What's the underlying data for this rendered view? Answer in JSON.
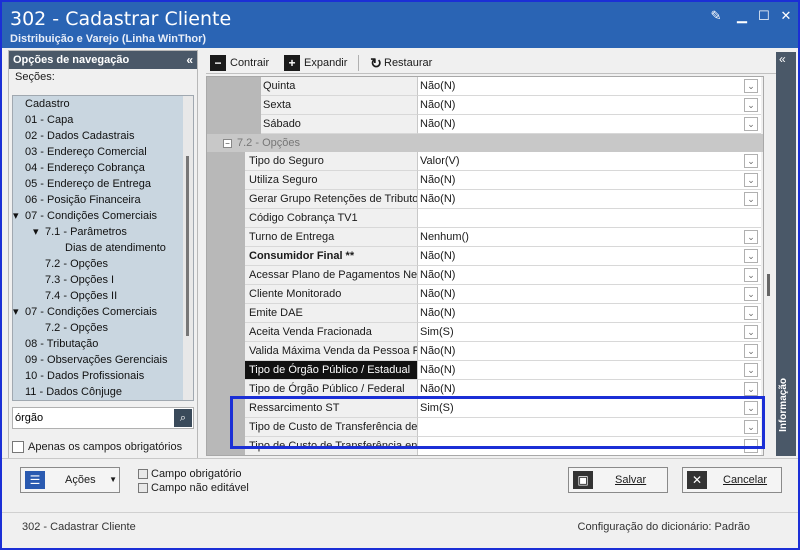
{
  "window": {
    "title": "302 - Cadastrar Cliente",
    "subtitle": "Distribuição e Varejo (Linha WinThor)"
  },
  "left_panel": {
    "header": "Opções de navegação",
    "sections_label": "Seções:",
    "tree": [
      {
        "label": "Cadastro",
        "level": 0,
        "expander": ""
      },
      {
        "label": "01 - Capa",
        "level": 0,
        "expander": ""
      },
      {
        "label": "02 - Dados Cadastrais",
        "level": 0,
        "expander": ""
      },
      {
        "label": "03 - Endereço Comercial",
        "level": 0,
        "expander": ""
      },
      {
        "label": "04 - Endereço Cobrança",
        "level": 0,
        "expander": ""
      },
      {
        "label": "05 - Endereço de Entrega",
        "level": 0,
        "expander": ""
      },
      {
        "label": "06 - Posição Financeira",
        "level": 0,
        "expander": ""
      },
      {
        "label": "07 - Condições Comerciais",
        "level": 0,
        "expander": "▾"
      },
      {
        "label": "7.1 - Parâmetros",
        "level": 1,
        "expander": "▾"
      },
      {
        "label": "Dias de atendimento",
        "level": 2,
        "expander": ""
      },
      {
        "label": "7.2 - Opções",
        "level": 1,
        "expander": ""
      },
      {
        "label": "7.3 - Opções I",
        "level": 1,
        "expander": ""
      },
      {
        "label": "7.4 - Opções II",
        "level": 1,
        "expander": ""
      },
      {
        "label": "07 - Condições Comerciais",
        "level": 0,
        "expander": "▾"
      },
      {
        "label": "7.2 - Opções",
        "level": 1,
        "expander": ""
      },
      {
        "label": "08 - Tributação",
        "level": 0,
        "expander": ""
      },
      {
        "label": "09 - Observações Gerenciais",
        "level": 0,
        "expander": ""
      },
      {
        "label": "10 - Dados Profissionais",
        "level": 0,
        "expander": ""
      },
      {
        "label": "11 - Dados Cônjuge",
        "level": 0,
        "expander": ""
      }
    ],
    "search_value": "órgão",
    "required_only_label": "Apenas os campos obrigatórios"
  },
  "toolbar": {
    "collapse_label": "Contrair",
    "expand_label": "Expandir",
    "restore_label": "Restaurar"
  },
  "grid": {
    "rows": [
      {
        "type": "field",
        "label": "Quinta",
        "value": "Não(N)",
        "dropdown": true,
        "indent": 2
      },
      {
        "type": "field",
        "label": "Sexta",
        "value": "Não(N)",
        "dropdown": true,
        "indent": 2
      },
      {
        "type": "field",
        "label": "Sábado",
        "value": "Não(N)",
        "dropdown": true,
        "indent": 2
      },
      {
        "type": "group",
        "label": "7.2 - Opções"
      },
      {
        "type": "field",
        "label": "Tipo do Seguro",
        "value": "Valor(V)",
        "dropdown": true,
        "indent": 1
      },
      {
        "type": "field",
        "label": "Utiliza Seguro",
        "value": "Não(N)",
        "dropdown": true,
        "indent": 1
      },
      {
        "type": "field",
        "label": "Gerar Grupo Retenções de Tributos",
        "value": "Não(N)",
        "dropdown": true,
        "indent": 1
      },
      {
        "type": "field",
        "label": "Código Cobrança TV1",
        "value": "",
        "dropdown": false,
        "indent": 1
      },
      {
        "type": "field",
        "label": "Turno de Entrega",
        "value": "Nenhum()",
        "dropdown": true,
        "indent": 1
      },
      {
        "type": "field",
        "label": "Consumidor Final **",
        "value": "Não(N)",
        "dropdown": true,
        "indent": 1,
        "bold": true
      },
      {
        "type": "field",
        "label": "Acessar Plano de Pagamentos Negociados",
        "value": "Não(N)",
        "dropdown": true,
        "indent": 1
      },
      {
        "type": "field",
        "label": "Cliente Monitorado",
        "value": "Não(N)",
        "dropdown": true,
        "indent": 1
      },
      {
        "type": "field",
        "label": "Emite DAE",
        "value": "Não(N)",
        "dropdown": true,
        "indent": 1
      },
      {
        "type": "field",
        "label": "Aceita Venda Fracionada",
        "value": "Sim(S)",
        "dropdown": true,
        "indent": 1
      },
      {
        "type": "field",
        "label": "Valida Máxima Venda da Pessoa Física",
        "value": "Não(N)",
        "dropdown": true,
        "indent": 1
      },
      {
        "type": "field",
        "label": "Tipo de Órgão Público / Estadual",
        "value": "Não(N)",
        "dropdown": true,
        "indent": 1,
        "selected": true
      },
      {
        "type": "field",
        "label": "Tipo de Órgão Público / Federal",
        "value": "Não(N)",
        "dropdown": true,
        "indent": 1
      },
      {
        "type": "field",
        "label": "Ressarcimento ST",
        "value": "Sim(S)",
        "dropdown": true,
        "indent": 1
      },
      {
        "type": "field",
        "label": "Tipo de Custo de Transferência de Entrada",
        "value": "",
        "dropdown": true,
        "indent": 1
      },
      {
        "type": "field",
        "label": "Tipo de Custo de Transferência entre Filiais",
        "value": "",
        "dropdown": true,
        "indent": 1
      }
    ]
  },
  "right_panel": {
    "label": "Informação"
  },
  "bottom": {
    "actions_label": "Ações",
    "required_field_label": "Campo obrigatório",
    "non_editable_label": "Campo não editável",
    "save_label": "Salvar",
    "cancel_label": "Cancelar"
  },
  "status": {
    "left": "302 - Cadastrar Cliente",
    "right": "Configuração do dicionário:  Padrão"
  },
  "colors": {
    "title_bar": "#2a64b4",
    "highlight": "#1b2fd6",
    "panel_header": "#4a5868",
    "tree_bg": "#c9d6e0"
  }
}
